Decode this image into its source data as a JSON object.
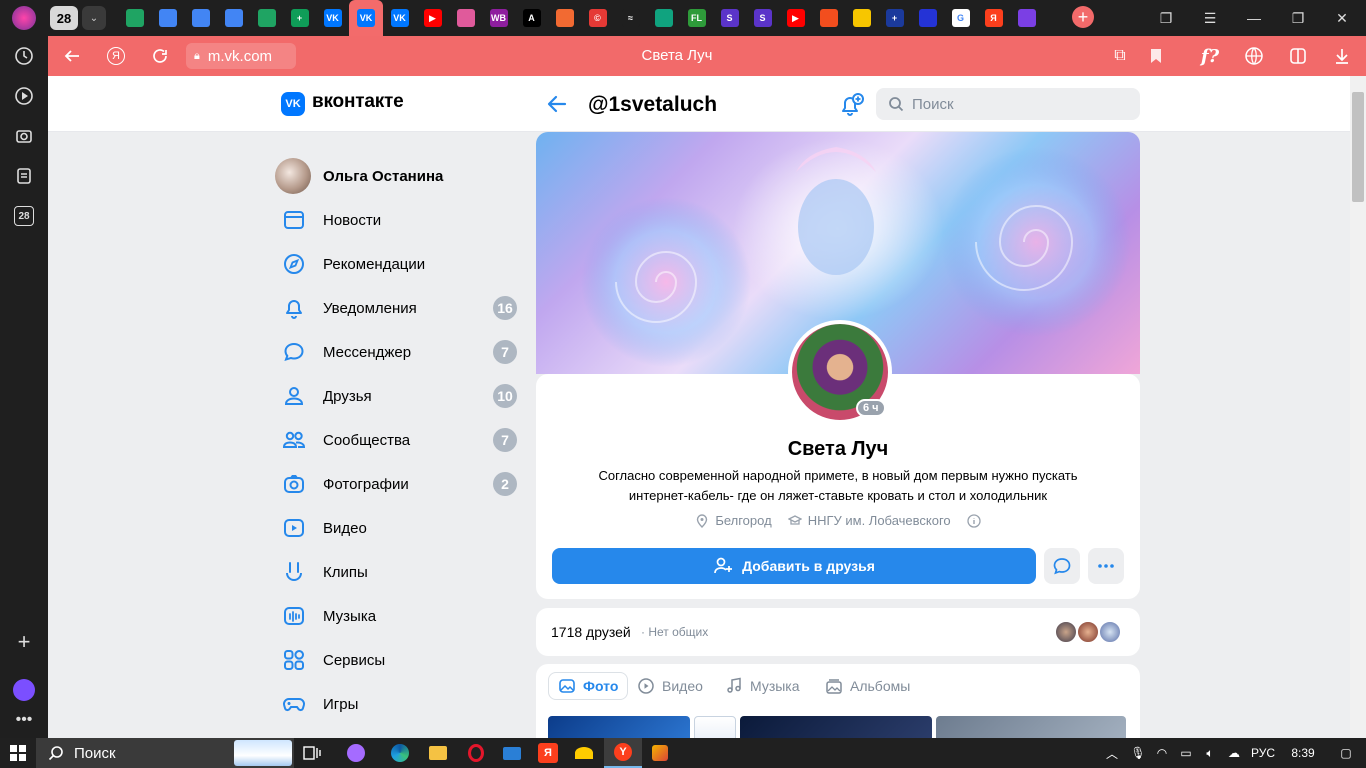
{
  "browser": {
    "tab_counter": "28",
    "url": "m.vk.com",
    "page_title": "Света Луч",
    "reader_label": "f?",
    "sidebar_counter": "28",
    "tab_favicons": [
      {
        "name": "google-drive",
        "color": "#1fa463",
        "text": ""
      },
      {
        "name": "google-docs",
        "color": "#4285f4",
        "text": ""
      },
      {
        "name": "google-docs",
        "color": "#4285f4",
        "text": ""
      },
      {
        "name": "google-docs",
        "color": "#4285f4",
        "text": ""
      },
      {
        "name": "google-drive",
        "color": "#1fa463",
        "text": ""
      },
      {
        "name": "google-sheets",
        "color": "#0f9d58",
        "text": "+"
      },
      {
        "name": "vk",
        "color": "#0077ff",
        "text": "VK"
      },
      {
        "name": "vk-active",
        "color": "#0077ff",
        "text": "VK"
      },
      {
        "name": "vk",
        "color": "#0077ff",
        "text": "VK"
      },
      {
        "name": "youtube",
        "color": "#ff0000",
        "text": "▶"
      },
      {
        "name": "colorful-app",
        "color": "#e05a9b",
        "text": ""
      },
      {
        "name": "wildberries",
        "color": "#8e1e9e",
        "text": "WB"
      },
      {
        "name": "a-app",
        "color": "#000000",
        "text": "A"
      },
      {
        "name": "orange-app",
        "color": "#f26a32",
        "text": ""
      },
      {
        "name": "copyright-app",
        "color": "#e53935",
        "text": "©"
      },
      {
        "name": "wave-app",
        "color": "#1f1f1f",
        "text": "≈"
      },
      {
        "name": "chatgpt",
        "color": "#10a37f",
        "text": ""
      },
      {
        "name": "fl",
        "color": "#2e9b3a",
        "text": "FL"
      },
      {
        "name": "s-app",
        "color": "#5b34c9",
        "text": "S"
      },
      {
        "name": "s-app",
        "color": "#5b34c9",
        "text": "S"
      },
      {
        "name": "youtube",
        "color": "#ff0000",
        "text": "▶"
      },
      {
        "name": "figma",
        "color": "#f24e1e",
        "text": ""
      },
      {
        "name": "image-app",
        "color": "#f7c600",
        "text": ""
      },
      {
        "name": "blue-plus",
        "color": "#1b3a9c",
        "text": "+"
      },
      {
        "name": "blue-dot",
        "color": "#2433d6",
        "text": ""
      },
      {
        "name": "google",
        "color": "#ffffff",
        "text": "G"
      },
      {
        "name": "yandex",
        "color": "#fc3f1d",
        "text": "Я"
      },
      {
        "name": "orb-app",
        "color": "#7b3fe4",
        "text": ""
      }
    ]
  },
  "vk": {
    "brand": "вконтакте",
    "logo_text": "VK",
    "profile_handle": "@1svetaluch",
    "search_placeholder": "Поиск"
  },
  "nav": {
    "user_name": "Ольга Останина",
    "items": [
      {
        "label": "Новости",
        "badge": "",
        "icon": "news-icon"
      },
      {
        "label": "Рекомендации",
        "badge": "",
        "icon": "compass-icon"
      },
      {
        "label": "Уведомления",
        "badge": "16",
        "icon": "bell-icon"
      },
      {
        "label": "Мессенджер",
        "badge": "7",
        "icon": "message-icon"
      },
      {
        "label": "Друзья",
        "badge": "10",
        "icon": "user-icon"
      },
      {
        "label": "Сообщества",
        "badge": "7",
        "icon": "users-icon"
      },
      {
        "label": "Фотографии",
        "badge": "2",
        "icon": "camera-icon"
      },
      {
        "label": "Видео",
        "badge": "",
        "icon": "video-icon"
      },
      {
        "label": "Клипы",
        "badge": "",
        "icon": "clips-icon"
      },
      {
        "label": "Музыка",
        "badge": "",
        "icon": "music-icon"
      },
      {
        "label": "Сервисы",
        "badge": "",
        "icon": "services-icon"
      },
      {
        "label": "Игры",
        "badge": "",
        "icon": "games-icon"
      }
    ]
  },
  "profile": {
    "name": "Света Луч",
    "online": "6 ч",
    "status": "Согласно современной народной примете, в новый дом первым нужно пускать интернет-кабель- где он ляжет-ставьте кровать и стол и холодильник",
    "city": "Белгород",
    "university": "ННГУ им. Лобачевского",
    "add_friend": "Добавить в друзья"
  },
  "friends": {
    "count": "1718 друзей",
    "common": "· Нет общих"
  },
  "media_tabs": [
    "Фото",
    "Видео",
    "Музыка",
    "Альбомы"
  ],
  "taskbar": {
    "search": "Поиск",
    "lang": "РУС",
    "time": "8:39"
  },
  "colors": {
    "accent": "#2688eb",
    "address_bar": "#f26a6a",
    "badge": "#aeb7c2"
  }
}
